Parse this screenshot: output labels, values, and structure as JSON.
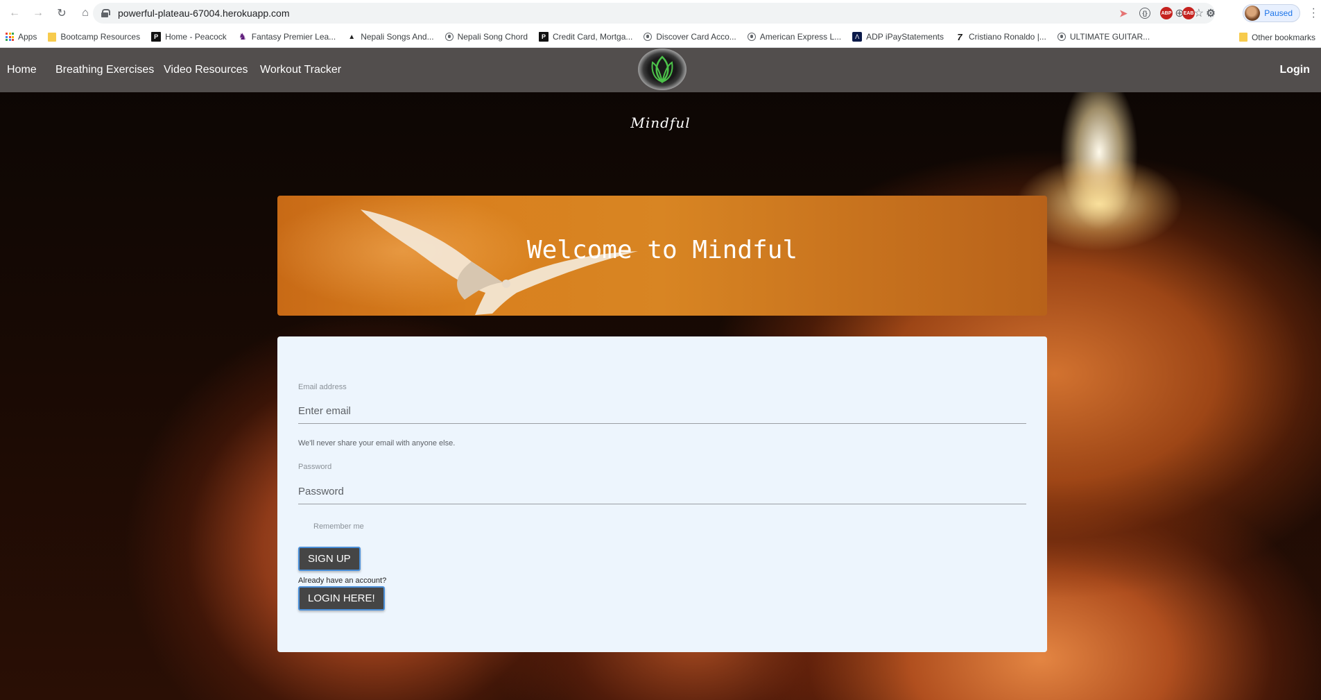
{
  "browser": {
    "url": "powerful-plateau-67004.herokuapp.com",
    "profile_status": "Paused",
    "bookmarks": [
      {
        "label": "Apps",
        "icon": "apps-grid-icon"
      },
      {
        "label": "Bootcamp Resources",
        "icon": "folder-icon"
      },
      {
        "label": "Home - Peacock",
        "icon": "peacock-icon"
      },
      {
        "label": "Fantasy Premier Lea...",
        "icon": "premier-league-icon"
      },
      {
        "label": "Nepali Songs And...",
        "icon": "triangle-icon"
      },
      {
        "label": "Nepali Song Chord",
        "icon": "globe-icon"
      },
      {
        "label": "Credit Card, Mortga...",
        "icon": "p-icon"
      },
      {
        "label": "Discover Card Acco...",
        "icon": "globe-icon"
      },
      {
        "label": "American Express L...",
        "icon": "globe-icon"
      },
      {
        "label": "ADP iPayStatements",
        "icon": "adp-icon"
      },
      {
        "label": "Cristiano Ronaldo |...",
        "icon": "slash-icon"
      },
      {
        "label": "ULTIMATE GUITAR...",
        "icon": "globe-icon"
      }
    ],
    "more_bookmarks": "»",
    "other_bookmarks": "Other bookmarks"
  },
  "navbar": {
    "links": [
      "Home",
      "Breathing Exercises",
      "Video Resources",
      "Workout Tracker"
    ],
    "login": "Login",
    "logo_icon": "lotus-logo-icon"
  },
  "brand": "Mindful",
  "hero": {
    "title": "Welcome to Mindful"
  },
  "form": {
    "email_label": "Email address",
    "email_placeholder": "Enter email",
    "email_help": "We'll never share your email with anyone else.",
    "password_label": "Password",
    "password_placeholder": "Password",
    "remember_label": "Remember me",
    "signup_button": "SIGN UP",
    "already_text": "Already have an account?",
    "login_button": "LOGIN HERE!"
  },
  "colors": {
    "navbar_bg": "#524e4d",
    "card_bg": "#edf5fd",
    "button_bg": "#454545",
    "button_border": "#4a8fd9",
    "hero_orange": "#d88523"
  }
}
